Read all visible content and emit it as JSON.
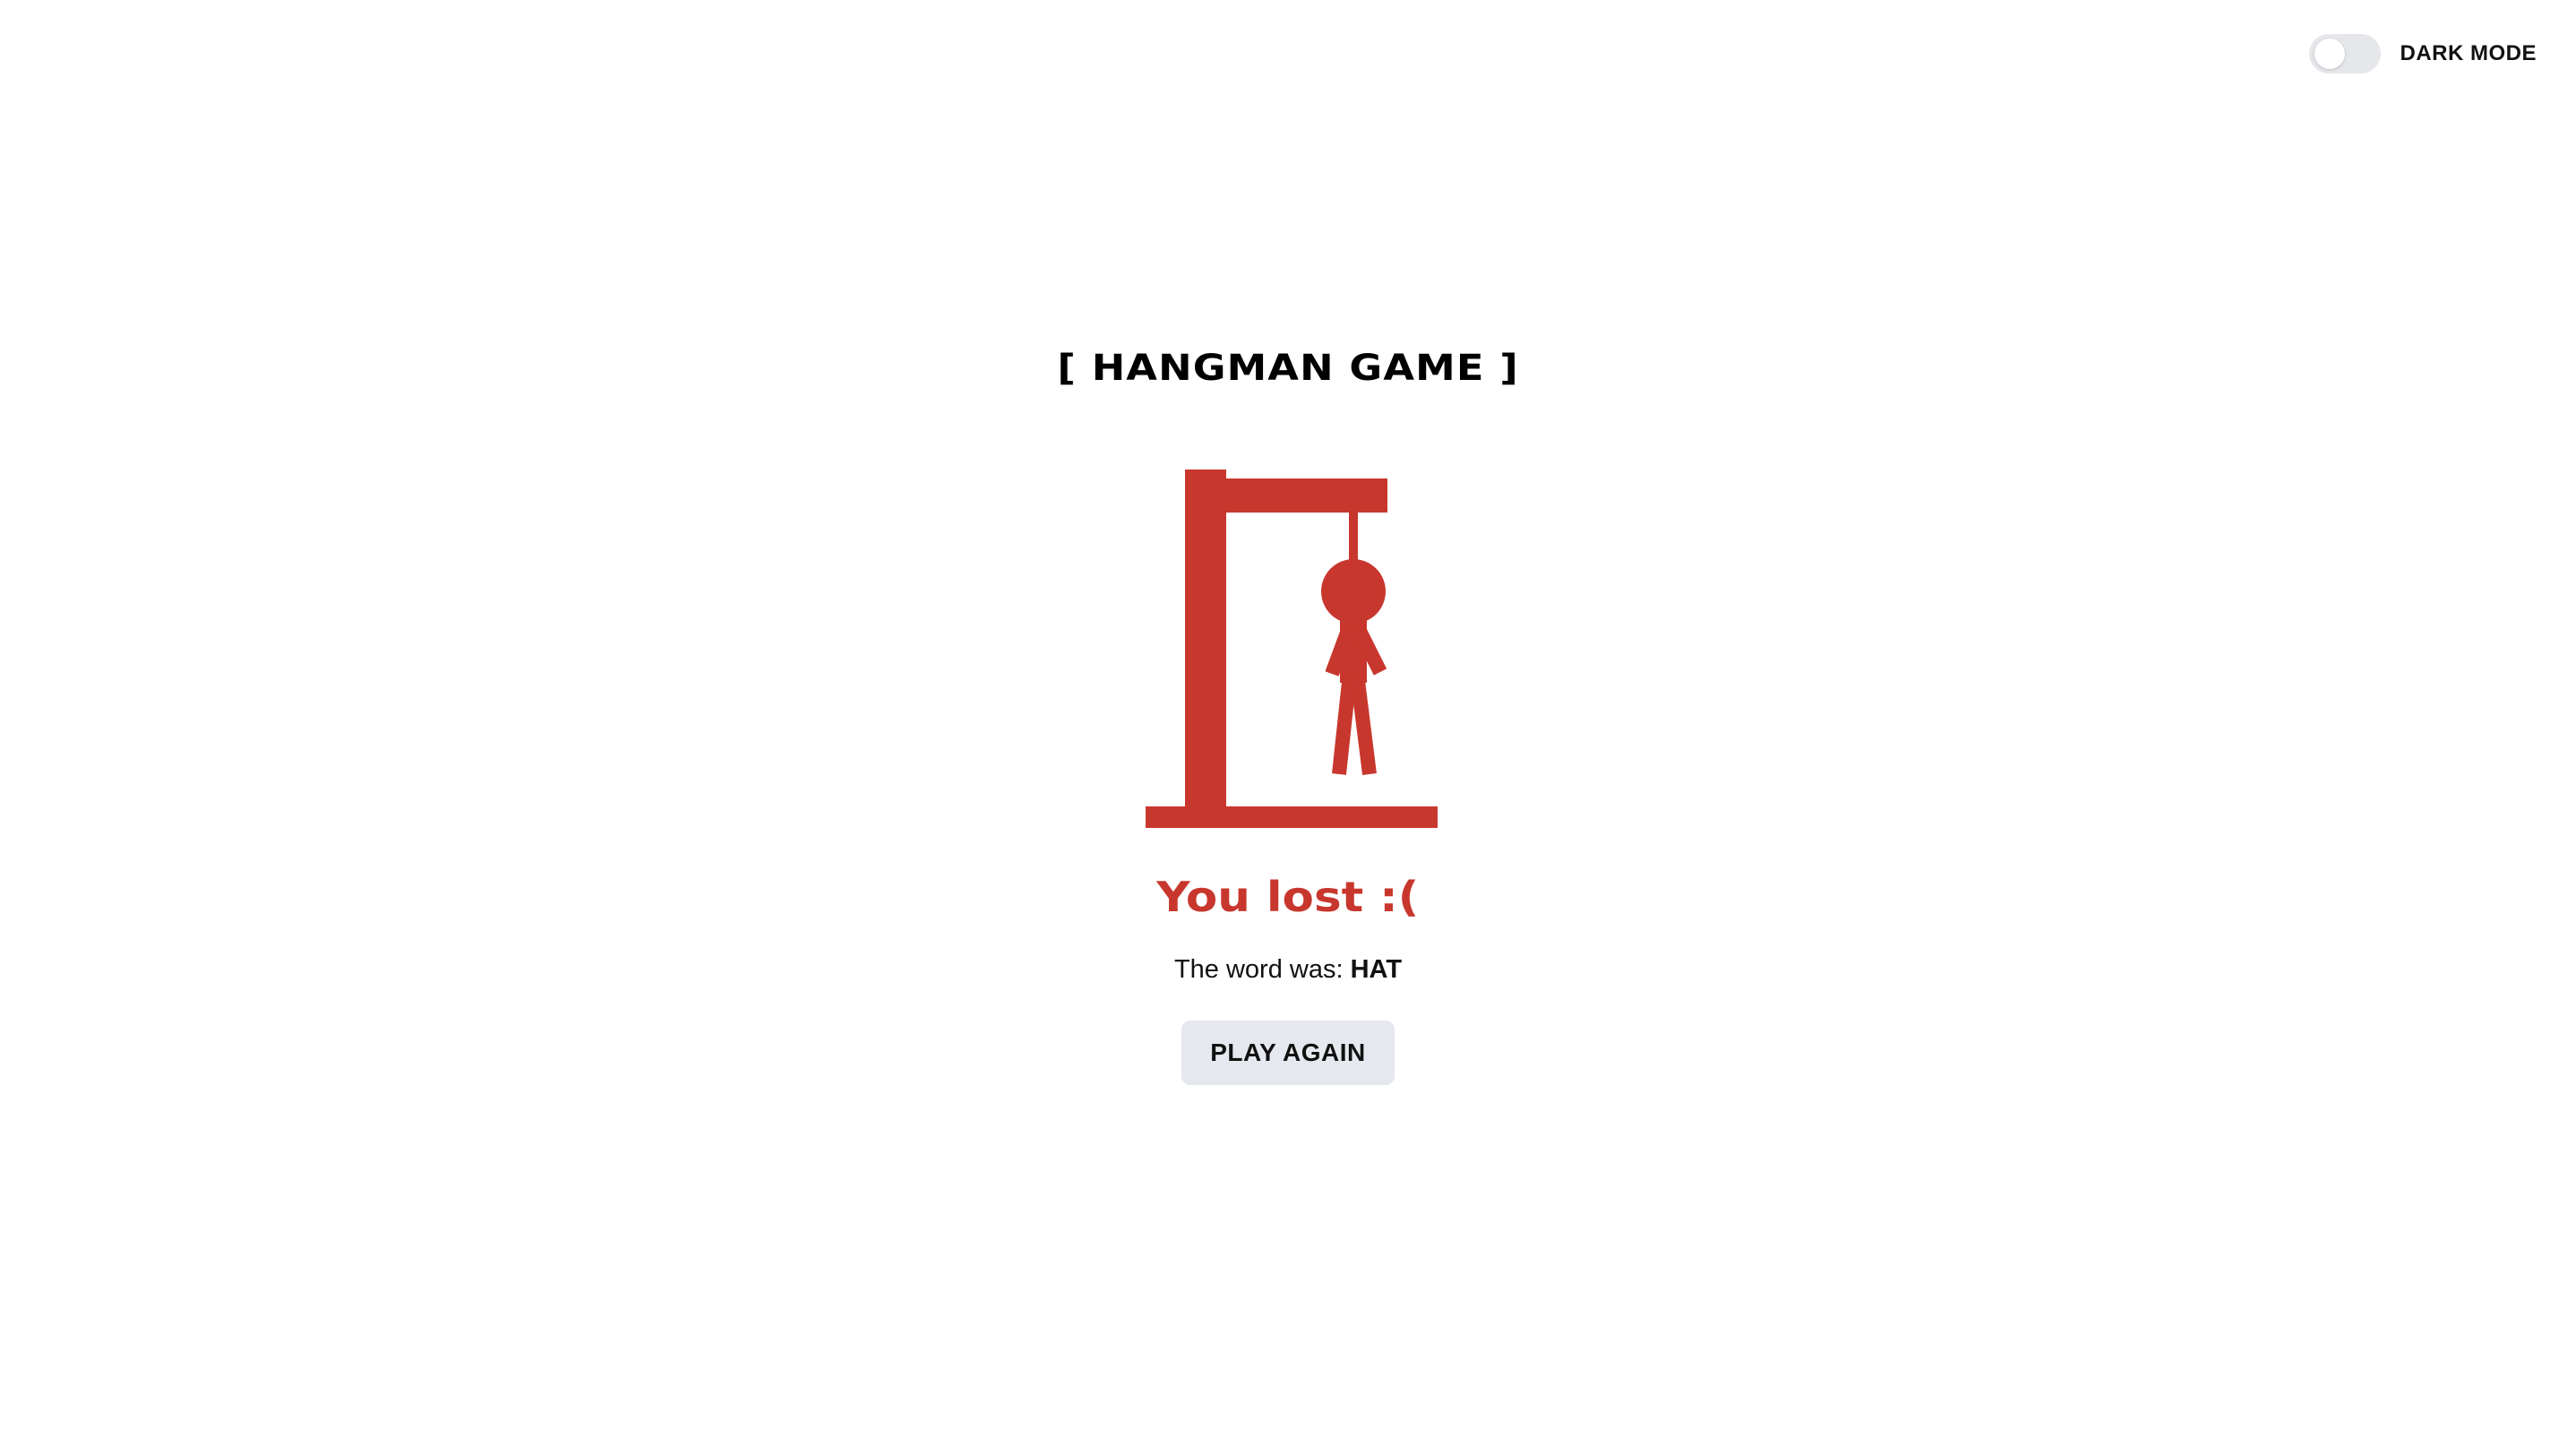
{
  "header": {
    "dark_mode_label": "DARK MODE",
    "dark_mode_on": false
  },
  "game": {
    "title": "[ HANGMAN GAME ]",
    "result_text": "You lost :(",
    "word_prefix": "The word was:",
    "word": "HAT",
    "play_again_label": "PLAY AGAIN"
  },
  "colors": {
    "accent": "#c8372d",
    "button_bg": "#e5e8ee",
    "toggle_track": "#e5e7eb"
  }
}
